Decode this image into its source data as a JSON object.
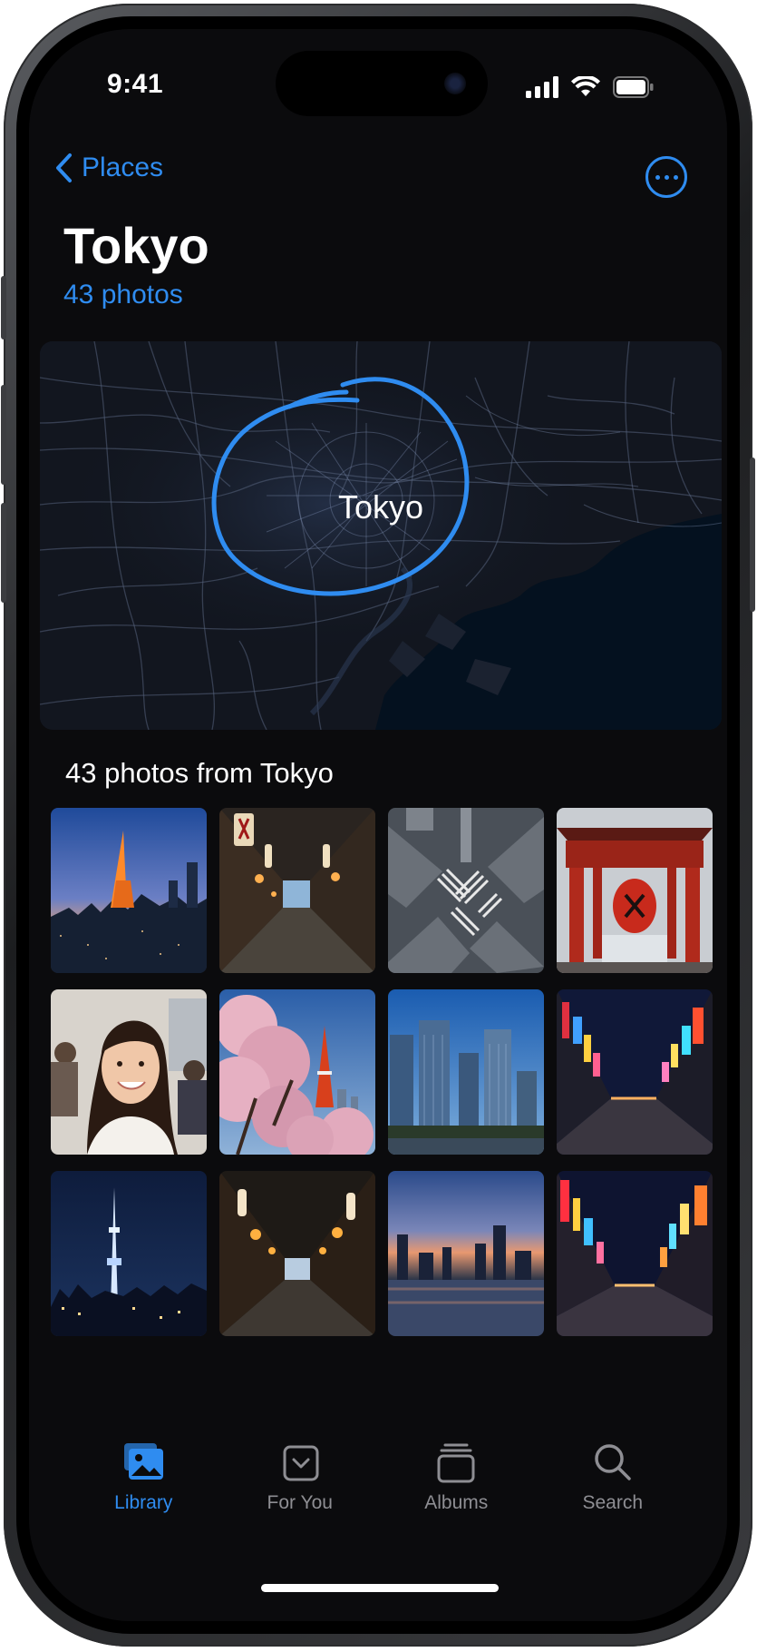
{
  "status_bar": {
    "time": "9:41"
  },
  "nav": {
    "back_label": "Places"
  },
  "header": {
    "title": "Tokyo",
    "subtitle": "43 photos"
  },
  "map": {
    "label": "Tokyo",
    "accent": "#2f8cf0"
  },
  "section": {
    "title": "43 photos from Tokyo"
  },
  "photos": [
    {
      "name": "tokyo-tower-dusk"
    },
    {
      "name": "lantern-alley"
    },
    {
      "name": "shibuya-crossing-aerial"
    },
    {
      "name": "temple-gate-lantern"
    },
    {
      "name": "smiling-woman-portrait"
    },
    {
      "name": "cherry-blossom-tower"
    },
    {
      "name": "skyscrapers-blue-sky"
    },
    {
      "name": "neon-street-night"
    },
    {
      "name": "skytree-night"
    },
    {
      "name": "lantern-alley-night"
    },
    {
      "name": "skyline-sunset-river"
    },
    {
      "name": "neon-avenue-night"
    }
  ],
  "tabbar": {
    "items": [
      {
        "label": "Library",
        "icon": "photo-library-icon",
        "active": true
      },
      {
        "label": "For You",
        "icon": "for-you-icon",
        "active": false
      },
      {
        "label": "Albums",
        "icon": "albums-icon",
        "active": false
      },
      {
        "label": "Search",
        "icon": "search-icon",
        "active": false
      }
    ]
  },
  "colors": {
    "accent": "#2f8cf0",
    "background": "#0b0b0d",
    "inactive": "#8e8e93"
  }
}
